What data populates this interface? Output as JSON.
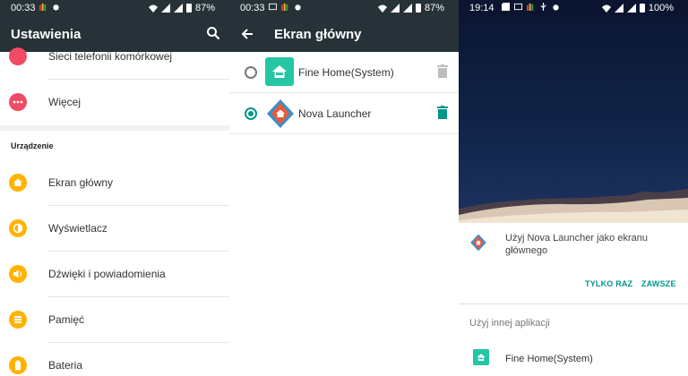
{
  "settings_screen": {
    "status": {
      "time": "00:33",
      "battery": "87%"
    },
    "title": "Ustawienia",
    "top_items": [
      {
        "label": "Sieci telefonii komórkowej",
        "icon": "antenna-icon",
        "color": "#f04b65"
      },
      {
        "label": "Więcej",
        "icon": "more-icon",
        "color": "#f04b65"
      }
    ],
    "section_header": "Urządzenie",
    "device_items": [
      {
        "label": "Ekran główny",
        "icon": "home-icon",
        "color": "#ffb300"
      },
      {
        "label": "Wyświetlacz",
        "icon": "brightness-icon",
        "color": "#ffb300"
      },
      {
        "label": "Dźwięki i powiadomienia",
        "icon": "volume-icon",
        "color": "#ffb300"
      },
      {
        "label": "Pamięć",
        "icon": "storage-icon",
        "color": "#ffb300"
      },
      {
        "label": "Bateria",
        "icon": "battery-icon",
        "color": "#ffb300"
      }
    ]
  },
  "home_screen": {
    "status": {
      "time": "00:33",
      "battery": "87%"
    },
    "title": "Ekran główny",
    "launchers": [
      {
        "label": "Fine Home(System)",
        "selected": false,
        "icon": "fine-home-icon"
      },
      {
        "label": "Nova Launcher",
        "selected": true,
        "icon": "nova-launcher-icon"
      }
    ],
    "accent": "#009688"
  },
  "chooser_dialog": {
    "status": {
      "time": "19:14",
      "battery": "100%"
    },
    "question": "Użyj Nova Launcher jako ekranu głównego",
    "button_once": "TYLKO RAZ",
    "button_always": "ZAWSZE",
    "other_apps_label": "Użyj innej aplikacji",
    "other_app": "Fine Home(System)"
  },
  "colors": {
    "appbar": "#263238",
    "teal": "#009688",
    "orange": "#ffb300",
    "pink": "#f04b65"
  }
}
